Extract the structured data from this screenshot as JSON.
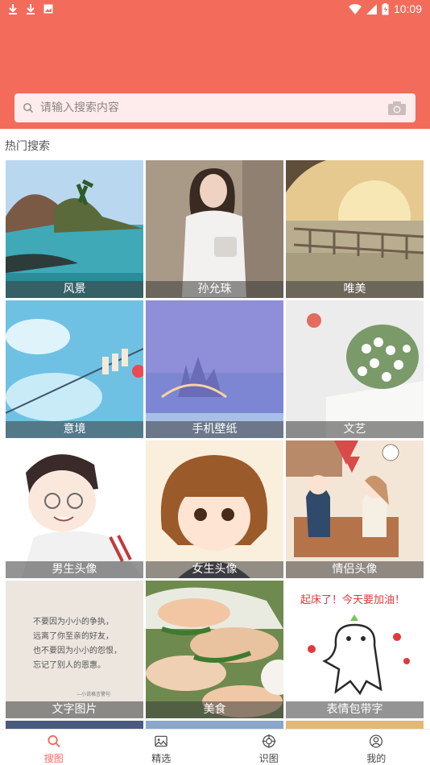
{
  "status_bar": {
    "time": "10:09"
  },
  "search": {
    "placeholder": "请输入搜索内容"
  },
  "section": {
    "title": "热门搜索"
  },
  "tiles": [
    {
      "label": "风景"
    },
    {
      "label": "孙允珠"
    },
    {
      "label": "唯美"
    },
    {
      "label": "意境"
    },
    {
      "label": "手机壁纸"
    },
    {
      "label": "文艺"
    },
    {
      "label": "男生头像"
    },
    {
      "label": "女生头像"
    },
    {
      "label": "情侣头像"
    },
    {
      "label": "文字图片"
    },
    {
      "label": "美食"
    },
    {
      "label": "表情包带字"
    }
  ],
  "tile_text": {
    "quote": [
      "不要因为小小的争执，",
      "远离了你至亲的好友，",
      "也不要因为小小的怨恨，",
      "忘记了别人的恩惠。"
    ],
    "quote_source": "—小说格言警句",
    "sticker": "起床了！今天要加油！"
  },
  "tabs": [
    {
      "label": "搜图",
      "icon": "search-icon",
      "active": true
    },
    {
      "label": "精选",
      "icon": "image-icon",
      "active": false
    },
    {
      "label": "识图",
      "icon": "target-icon",
      "active": false
    },
    {
      "label": "我的",
      "icon": "user-icon",
      "active": false
    }
  ],
  "colors": {
    "accent": "#f26b5b",
    "search_bg": "#fdeceb"
  }
}
